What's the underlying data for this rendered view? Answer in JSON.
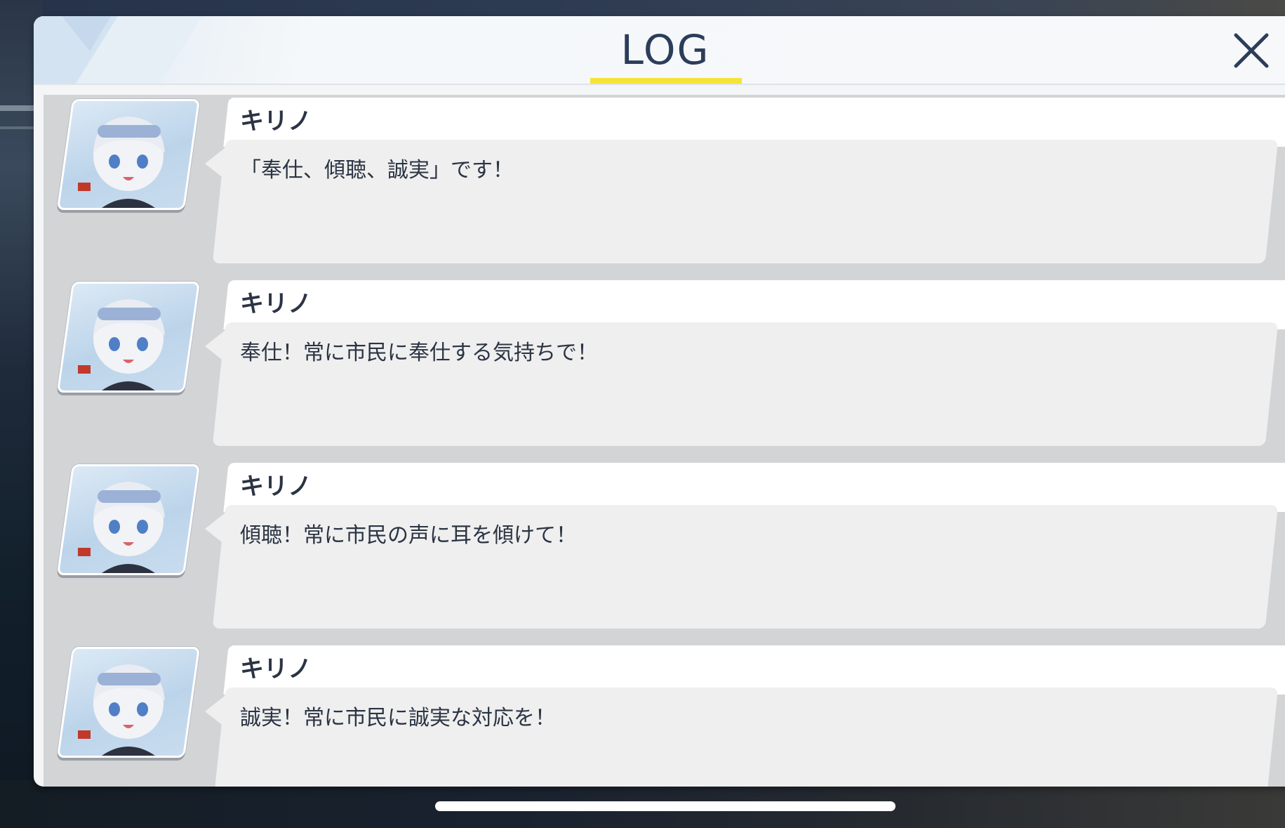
{
  "header": {
    "title": "LOG",
    "close_icon": "close-icon",
    "accent_underline_color": "#f5e437"
  },
  "entries": [
    {
      "speaker": "キリノ",
      "text": "「奉仕、傾聴、誠実」です！",
      "avatar_icon": "character-portrait-icon"
    },
    {
      "speaker": "キリノ",
      "text": "奉仕！常に市民に奉仕する気持ちで！",
      "avatar_icon": "character-portrait-icon"
    },
    {
      "speaker": "キリノ",
      "text": "傾聴！常に市民の声に耳を傾けて！",
      "avatar_icon": "character-portrait-icon"
    },
    {
      "speaker": "キリノ",
      "text": "誠実！常に市民に誠実な対応を！",
      "avatar_icon": "character-portrait-icon"
    }
  ],
  "colors": {
    "panel_bg": "#f3f5f7",
    "list_bg": "#d3d4d6",
    "bubble_bg": "#efefef",
    "name_strip_bg": "#ffffff",
    "text": "#2b3443",
    "title_text": "#2c3d5a"
  }
}
